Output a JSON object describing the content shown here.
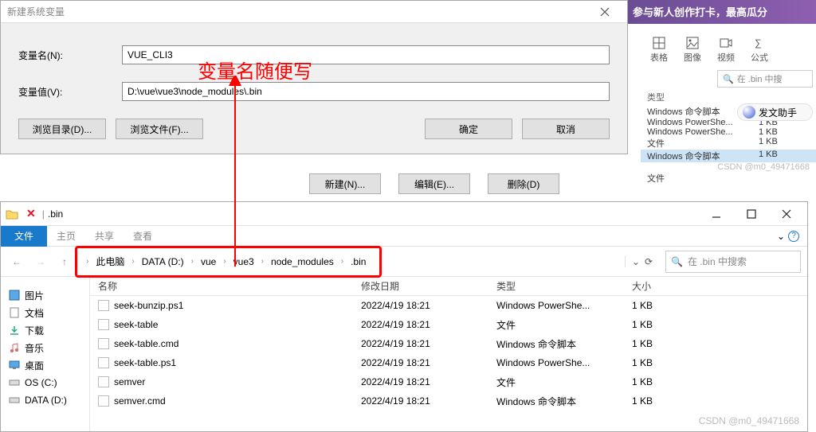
{
  "banner": "参与新人创作打卡，最高瓜分",
  "bg_icons": {
    "table": "表格",
    "image": "图像",
    "video": "视频",
    "formula": "公式"
  },
  "bg_search_ph": "在 .bin 中搜",
  "bg_hdr": "类型",
  "bg_rows": [
    {
      "t": "Windows 命令脚本",
      "s": ""
    },
    {
      "t": "Windows PowerShe...",
      "s": "1 KB"
    },
    {
      "t": "Windows PowerShe...",
      "s": "1 KB"
    },
    {
      "t": "文件",
      "s": "1 KB"
    },
    {
      "t": "Windows 命令脚本",
      "s": "1 KB"
    },
    {
      "t": "文件",
      "s": ""
    }
  ],
  "bg_watermark": "CSDN @m0_49471668",
  "assist": "发文助手",
  "dialog": {
    "title": "新建系统变量",
    "name_label": "变量名(N):",
    "name_value": "VUE_CLI3",
    "value_label": "变量值(V):",
    "value_value": "D:\\vue\\vue3\\node_modules\\.bin",
    "browse_dir": "浏览目录(D)...",
    "browse_file": "浏览文件(F)...",
    "ok": "确定",
    "cancel": "取消"
  },
  "lower": {
    "new": "新建(N)...",
    "edit": "编辑(E)...",
    "delete": "删除(D)"
  },
  "annotation": "变量名随便写",
  "explorer": {
    "title_folder": ".bin",
    "tab_file": "文件",
    "tab_home": "主页",
    "tab_share": "共享",
    "tab_view": "查看",
    "crumbs": [
      "此电脑",
      "DATA (D:)",
      "vue",
      "vue3",
      "node_modules",
      ".bin"
    ],
    "search_ph": "在 .bin 中搜索",
    "nav": [
      "图片",
      "文档",
      "下载",
      "音乐",
      "桌面",
      "OS (C:)",
      "DATA (D:)"
    ],
    "cols": {
      "name": "名称",
      "date": "修改日期",
      "type": "类型",
      "size": "大小"
    },
    "files": [
      {
        "name": "seek-bunzip.ps1",
        "date": "2022/4/19 18:21",
        "type": "Windows PowerShe...",
        "size": "1 KB"
      },
      {
        "name": "seek-table",
        "date": "2022/4/19 18:21",
        "type": "文件",
        "size": "1 KB"
      },
      {
        "name": "seek-table.cmd",
        "date": "2022/4/19 18:21",
        "type": "Windows 命令脚本",
        "size": "1 KB"
      },
      {
        "name": "seek-table.ps1",
        "date": "2022/4/19 18:21",
        "type": "Windows PowerShe...",
        "size": "1 KB"
      },
      {
        "name": "semver",
        "date": "2022/4/19 18:21",
        "type": "文件",
        "size": "1 KB"
      },
      {
        "name": "semver.cmd",
        "date": "2022/4/19 18:21",
        "type": "Windows 命令脚本",
        "size": "1 KB"
      }
    ],
    "watermark": "CSDN @m0_49471668"
  }
}
